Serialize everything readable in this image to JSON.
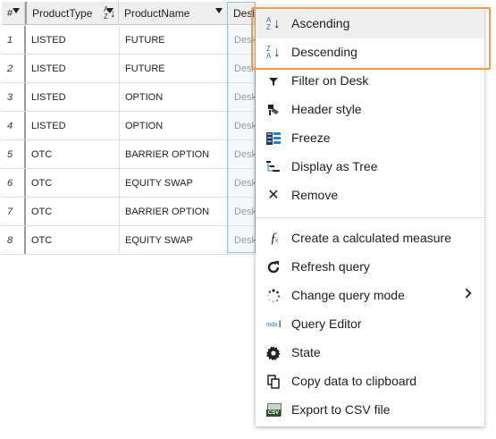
{
  "table": {
    "headers": {
      "index": "#",
      "product_type": "ProductType",
      "product_name": "ProductName",
      "desk": "Desk"
    },
    "rows": [
      {
        "index": "1",
        "product_type": "LISTED",
        "product_name": "FUTURE",
        "desk": "DeskB"
      },
      {
        "index": "2",
        "product_type": "LISTED",
        "product_name": "FUTURE",
        "desk": "DeskA"
      },
      {
        "index": "3",
        "product_type": "LISTED",
        "product_name": "OPTION",
        "desk": "DeskA"
      },
      {
        "index": "4",
        "product_type": "LISTED",
        "product_name": "OPTION",
        "desk": "DeskB"
      },
      {
        "index": "5",
        "product_type": "OTC",
        "product_name": "BARRIER OPTION",
        "desk": "DeskB"
      },
      {
        "index": "6",
        "product_type": "OTC",
        "product_name": "EQUITY SWAP",
        "desk": "DeskA"
      },
      {
        "index": "7",
        "product_type": "OTC",
        "product_name": "BARRIER OPTION",
        "desk": "DeskA"
      },
      {
        "index": "8",
        "product_type": "OTC",
        "product_name": "EQUITY SWAP",
        "desk": "DeskB"
      }
    ]
  },
  "context_menu": {
    "items": [
      {
        "label": "Ascending",
        "icon": "sort-ascending-icon"
      },
      {
        "label": "Descending",
        "icon": "sort-descending-icon"
      },
      {
        "label": "Filter on Desk",
        "icon": "filter-icon"
      },
      {
        "label": "Header style",
        "icon": "paint-icon"
      },
      {
        "label": "Freeze",
        "icon": "freeze-icon"
      },
      {
        "label": "Display as Tree",
        "icon": "tree-icon"
      },
      {
        "label": "Remove",
        "icon": "close-icon"
      },
      {
        "label": "Create a calculated measure",
        "icon": "function-icon"
      },
      {
        "label": "Refresh query",
        "icon": "refresh-icon"
      },
      {
        "label": "Change query mode",
        "icon": "spinner-icon"
      },
      {
        "label": "Query Editor",
        "icon": "mdx-icon"
      },
      {
        "label": "State",
        "icon": "gear-icon"
      },
      {
        "label": "Copy data to clipboard",
        "icon": "copy-icon"
      },
      {
        "label": "Export to CSV file",
        "icon": "csv-icon"
      }
    ],
    "sort_icon_letters": {
      "top": "A",
      "bottom": "Z"
    },
    "mdx_icon_text": "mdx",
    "csv_icon_text": "CSV"
  },
  "colors": {
    "highlight_frame": "#f29a43",
    "hover_row": "#efefef",
    "desk_column_outline": "#9ec3e0"
  }
}
